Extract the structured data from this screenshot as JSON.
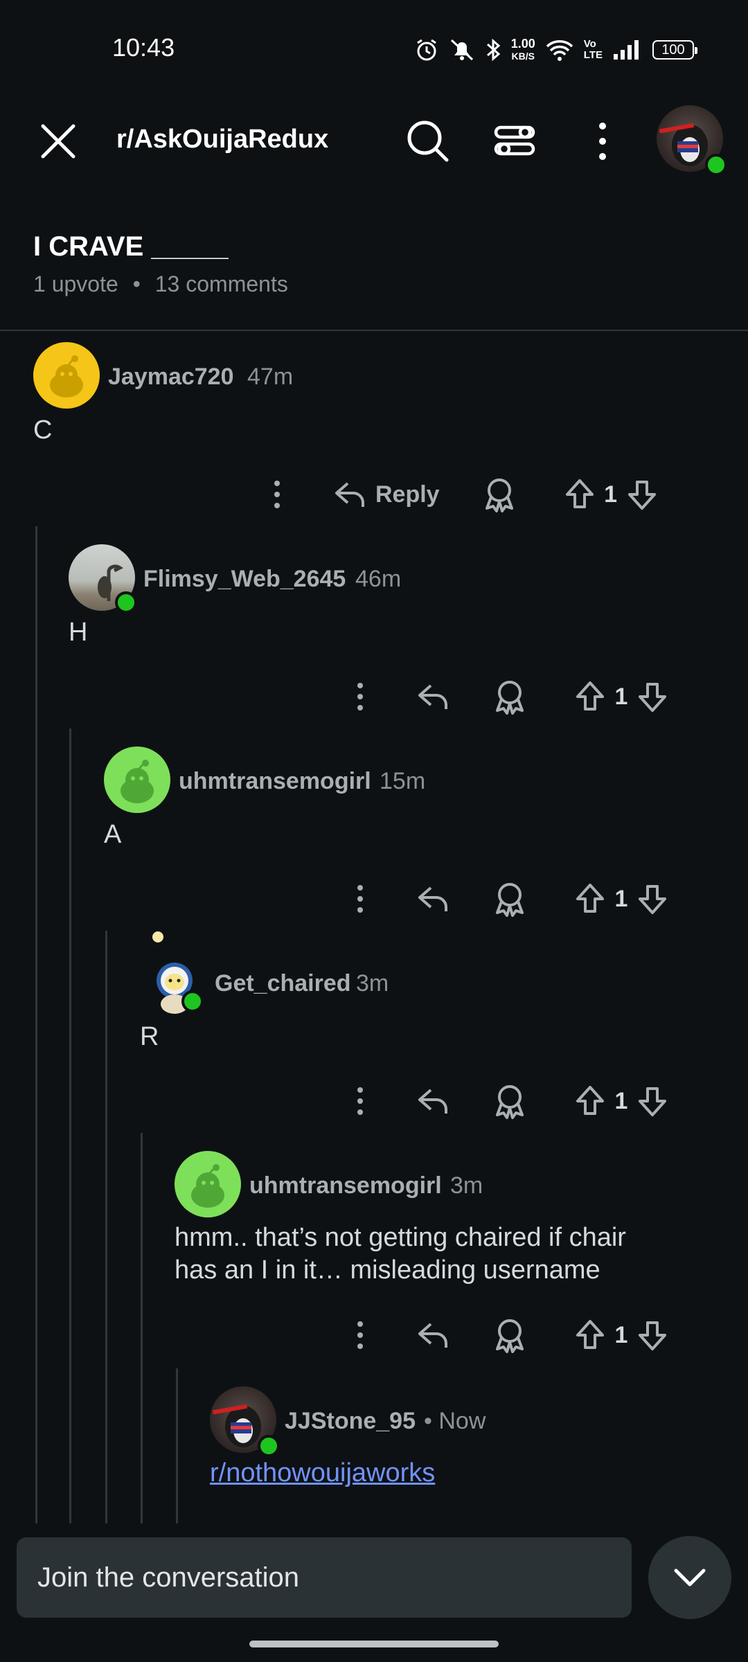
{
  "status_bar": {
    "time": "10:43",
    "net_speed_value": "1.00",
    "net_speed_unit": "KB/S",
    "volte": "Vo\nLTE",
    "battery": "100"
  },
  "header": {
    "subreddit": "r/AskOuijaRedux"
  },
  "post": {
    "title": "I CRAVE _____",
    "upvotes": "1 upvote",
    "separator": "•",
    "comments": "13 comments"
  },
  "comments": [
    {
      "username": "Jaymac720",
      "age": "47m",
      "body": "C",
      "reply_label": "Reply",
      "votes": "1"
    },
    {
      "username": "Flimsy_Web_2645",
      "age": "46m",
      "body": "H",
      "votes": "1"
    },
    {
      "username": "uhmtransemogirl",
      "age": "15m",
      "body": "A",
      "votes": "1"
    },
    {
      "username": "Get_chaired",
      "age": "3m",
      "body": "R",
      "votes": "1"
    },
    {
      "username": "uhmtransemogirl",
      "age": "3m",
      "body_line1": "hmm.. that’s not getting chaired if chair",
      "body_line2": "has an I in it… misleading username",
      "votes": "1"
    },
    {
      "username": "JJStone_95",
      "age": "• Now",
      "link": "r/nothowouijaworks"
    }
  ],
  "composer": {
    "placeholder": "Join the conversation"
  },
  "colors": {
    "background": "#0e1113",
    "online": "#1ec51e",
    "link": "#7193ff",
    "snoo_yellow": "#f5c518",
    "snoo_green": "#7ee05a"
  },
  "icons": [
    "close-icon",
    "search-icon",
    "filter-icon",
    "more-vertical-icon",
    "reply-icon",
    "award-icon",
    "upvote-icon",
    "downvote-icon",
    "chevron-down-icon"
  ]
}
